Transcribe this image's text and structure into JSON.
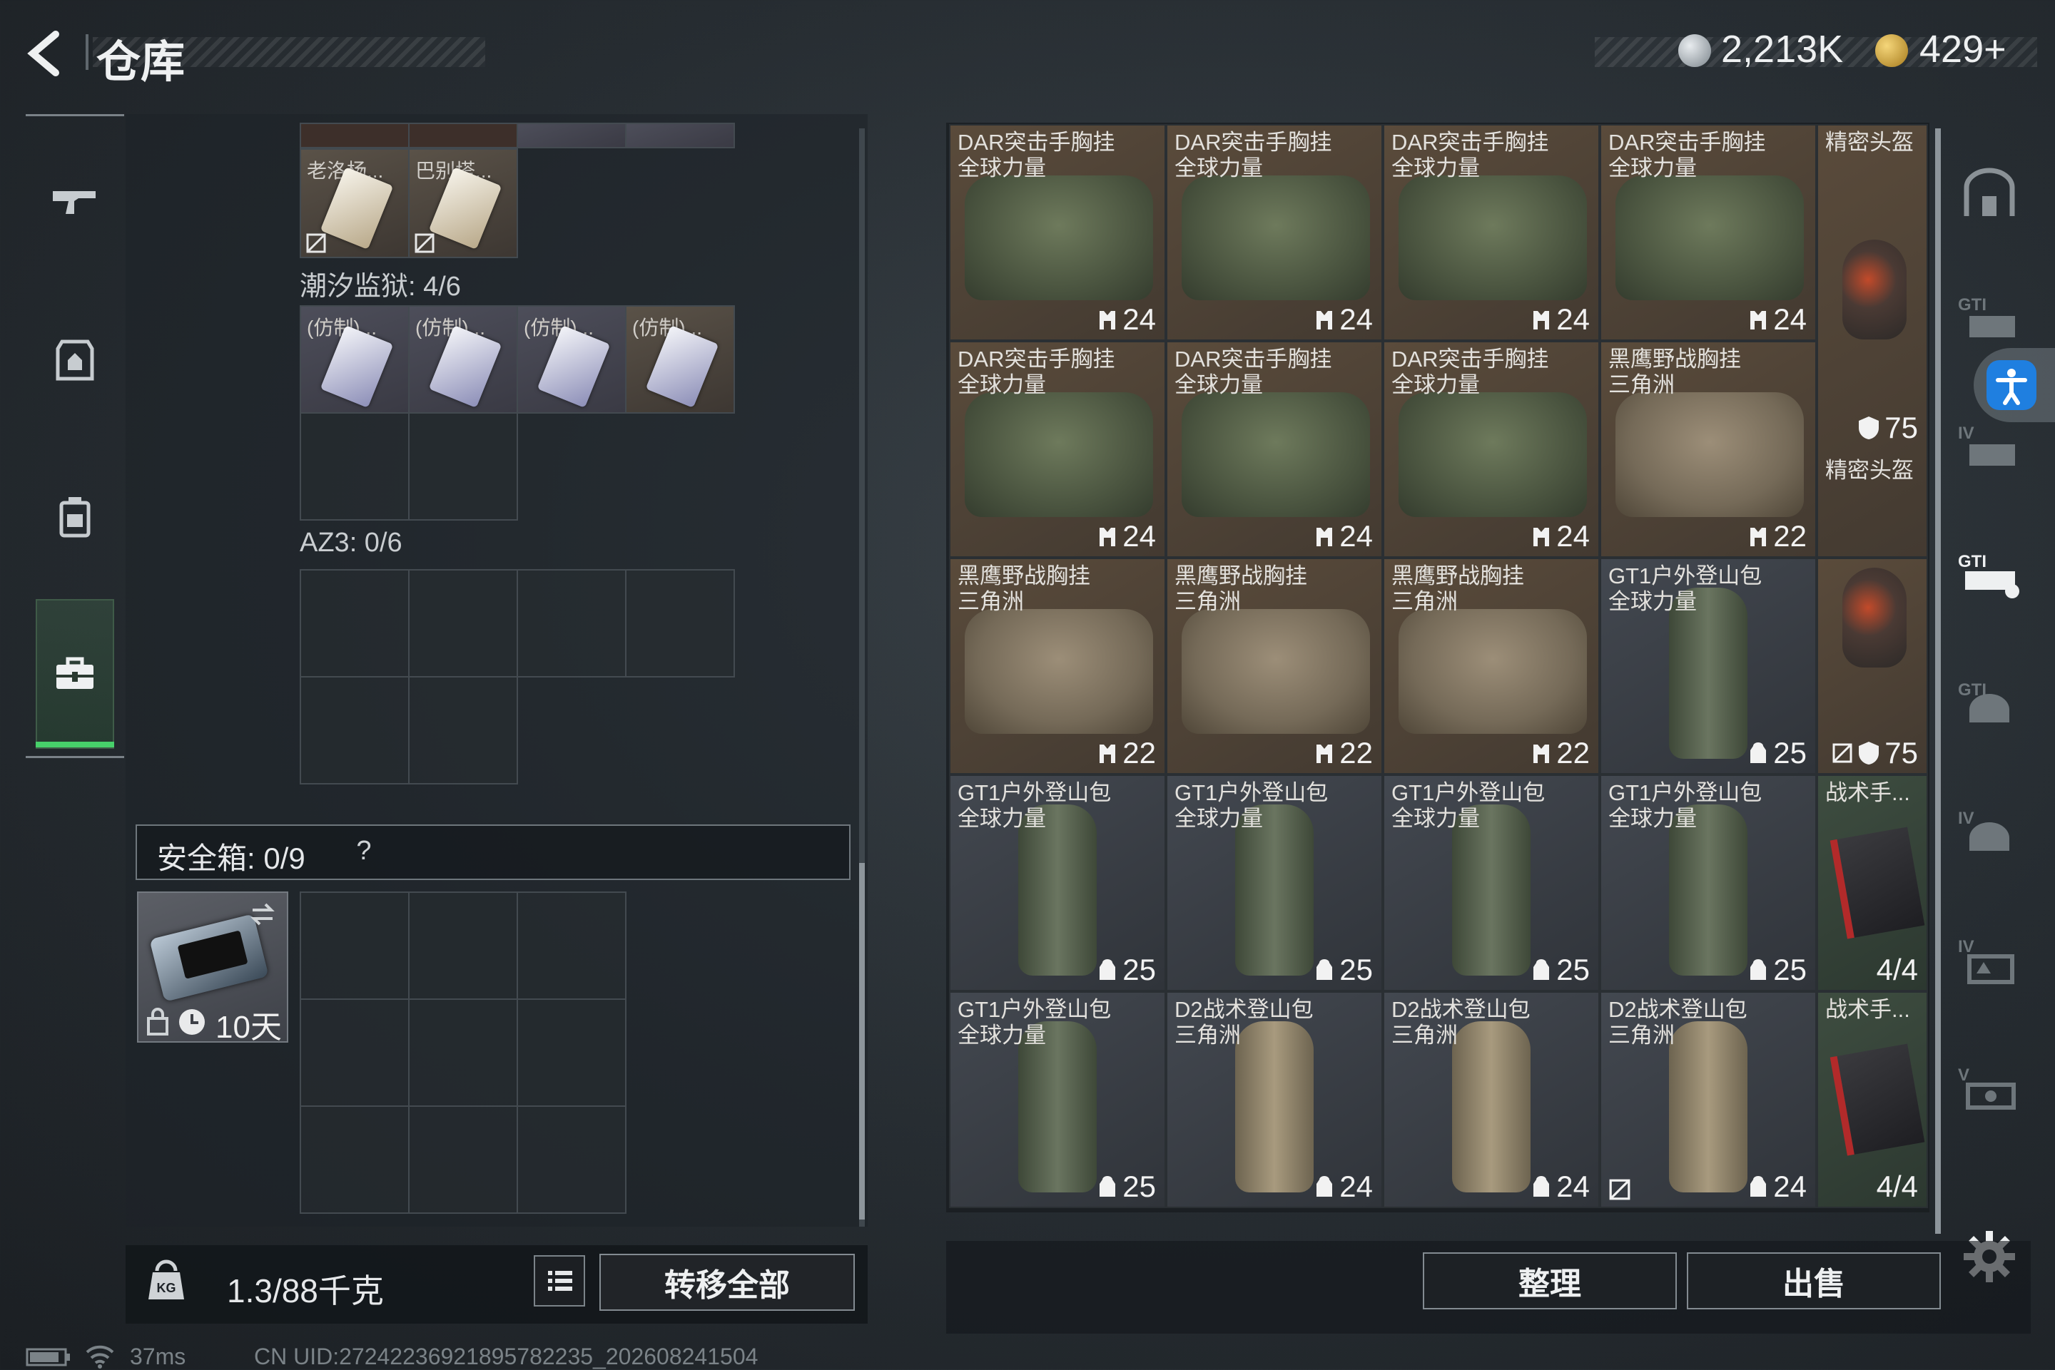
{
  "header": {
    "title": "仓库",
    "currency_1": "2,213K",
    "currency_2": "429+"
  },
  "sidebar": {
    "items": [
      "gun-icon",
      "vest-icon",
      "backpack-icon",
      "case-icon"
    ],
    "active_index": 3
  },
  "left_panel": {
    "top_row_items": [
      {
        "label": "老洛杨..."
      },
      {
        "label": "巴别塔..."
      }
    ],
    "section_1": {
      "label": "潮汐监狱: 4/6",
      "items": [
        "(仿制)...",
        "(仿制)...",
        "(仿制)...",
        "(仿制)..."
      ]
    },
    "section_2": {
      "label": "AZ3: 0/6"
    },
    "safebox": {
      "label": "安全箱: 0/9",
      "help": "?",
      "days": "10天"
    },
    "weight": "1.3/88千克",
    "transfer_all": "转移全部"
  },
  "grid": {
    "rows": [
      [
        {
          "name": "DAR突击手胸挂",
          "sub": "全球力量",
          "value": "24",
          "icon": "vest-capacity-icon"
        },
        {
          "name": "DAR突击手胸挂",
          "sub": "全球力量",
          "value": "24",
          "icon": "vest-capacity-icon"
        },
        {
          "name": "DAR突击手胸挂",
          "sub": "全球力量",
          "value": "24",
          "icon": "vest-capacity-icon"
        },
        {
          "name": "DAR突击手胸挂",
          "sub": "全球力量",
          "value": "24",
          "icon": "vest-capacity-icon"
        }
      ],
      [
        {
          "name": "DAR突击手胸挂",
          "sub": "全球力量",
          "value": "24",
          "icon": "vest-capacity-icon"
        },
        {
          "name": "DAR突击手胸挂",
          "sub": "全球力量",
          "value": "24",
          "icon": "vest-capacity-icon"
        },
        {
          "name": "DAR突击手胸挂",
          "sub": "全球力量",
          "value": "24",
          "icon": "vest-capacity-icon"
        },
        {
          "name": "黑鹰野战胸挂",
          "sub": "三角洲",
          "value": "22",
          "icon": "vest-capacity-icon"
        }
      ],
      [
        {
          "name": "黑鹰野战胸挂",
          "sub": "三角洲",
          "value": "22",
          "icon": "vest-capacity-icon"
        },
        {
          "name": "黑鹰野战胸挂",
          "sub": "三角洲",
          "value": "22",
          "icon": "vest-capacity-icon"
        },
        {
          "name": "黑鹰野战胸挂",
          "sub": "三角洲",
          "value": "22",
          "icon": "vest-capacity-icon"
        },
        {
          "name": "GT1户外登山包",
          "sub": "全球力量",
          "value": "25",
          "icon": "backpack-capacity-icon"
        }
      ],
      [
        {
          "name": "GT1户外登山包",
          "sub": "全球力量",
          "value": "25",
          "icon": "backpack-capacity-icon"
        },
        {
          "name": "GT1户外登山包",
          "sub": "全球力量",
          "value": "25",
          "icon": "backpack-capacity-icon"
        },
        {
          "name": "GT1户外登山包",
          "sub": "全球力量",
          "value": "25",
          "icon": "backpack-capacity-icon"
        },
        {
          "name": "GT1户外登山包",
          "sub": "全球力量",
          "value": "25",
          "icon": "backpack-capacity-icon"
        }
      ],
      [
        {
          "name": "GT1户外登山包",
          "sub": "全球力量",
          "value": "25",
          "icon": "backpack-capacity-icon"
        },
        {
          "name": "D2战术登山包",
          "sub": "三角洲",
          "value": "24",
          "icon": "backpack-capacity-icon"
        },
        {
          "name": "D2战术登山包",
          "sub": "三角洲",
          "value": "24",
          "icon": "backpack-capacity-icon"
        },
        {
          "name": "D2战术登山包",
          "sub": "三角洲",
          "value": "24",
          "icon": "backpack-capacity-icon"
        }
      ]
    ],
    "right_column": [
      {
        "name": "精密头盔",
        "value": "75"
      },
      {
        "name": "精密头盔",
        "value": "75"
      },
      {
        "name": "战术手...",
        "value": "4/4"
      },
      {
        "name": "战术手...",
        "value": "4/4"
      }
    ]
  },
  "buttons": {
    "organize": "整理",
    "sell": "出售"
  },
  "right_tabs": [
    "armory-icon",
    "gti-vest-icon",
    "iv-vest-icon",
    "gti-backpack-icon",
    "gti-helmet-icon",
    "iv-helmet-icon",
    "iv-case-icon",
    "v-case-icon"
  ],
  "status": {
    "ping": "37ms",
    "uid": "CN UID:27242236921895782235_202608241504"
  },
  "colors": {
    "accent_green": "#47d06a",
    "access_blue": "#1f7fe0"
  }
}
